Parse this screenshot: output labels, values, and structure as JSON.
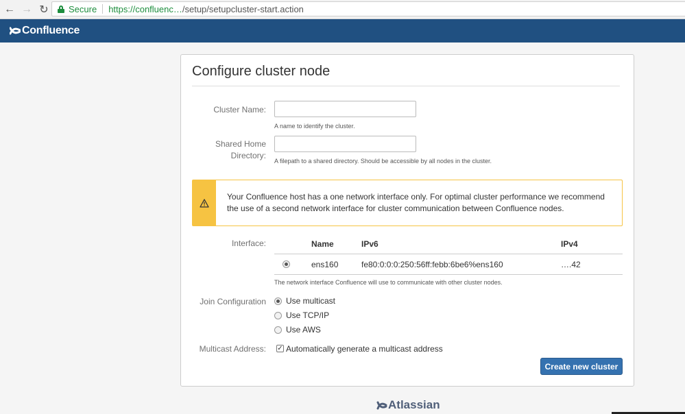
{
  "browser": {
    "secure_label": "Secure",
    "url_scheme_host": "https://confluenc…",
    "url_path": "/setup/setupcluster-start.action"
  },
  "app": {
    "logo_text": "Confluence"
  },
  "form": {
    "title": "Configure cluster node",
    "cluster_name": {
      "label": "Cluster Name:",
      "value": "",
      "hint": "A name to identify the cluster."
    },
    "shared_home": {
      "label": "Shared Home Directory:",
      "value": "",
      "hint": "A filepath to a shared directory. Should be accessible by all nodes in the cluster."
    },
    "warning": "Your Confluence host has a one network interface only. For optimal cluster performance we recommend the use of a second network interface for cluster communication between Confluence nodes.",
    "interface": {
      "label": "Interface:",
      "columns": [
        "Name",
        "IPv6",
        "IPv4"
      ],
      "rows": [
        {
          "name": "ens160",
          "ipv6": "fe80:0:0:0:250:56ff:febb:6be6%ens160",
          "ipv4": "….42",
          "selected": true
        }
      ],
      "hint": "The network interface Confluence will use to communicate with other cluster nodes."
    },
    "join_configuration": {
      "label": "Join Configuration",
      "options": [
        "Use multicast",
        "Use TCP/IP",
        "Use AWS"
      ],
      "selected": "Use multicast"
    },
    "multicast_address": {
      "label": "Multicast Address:",
      "checkbox_label": "Automatically generate a multicast address",
      "checked": true
    },
    "submit_label": "Create new cluster"
  },
  "footer": {
    "logo_text": "Atlassian"
  },
  "colors": {
    "header_bg": "#205081",
    "primary_button": "#3572b0",
    "warning_accent": "#f6c342"
  }
}
